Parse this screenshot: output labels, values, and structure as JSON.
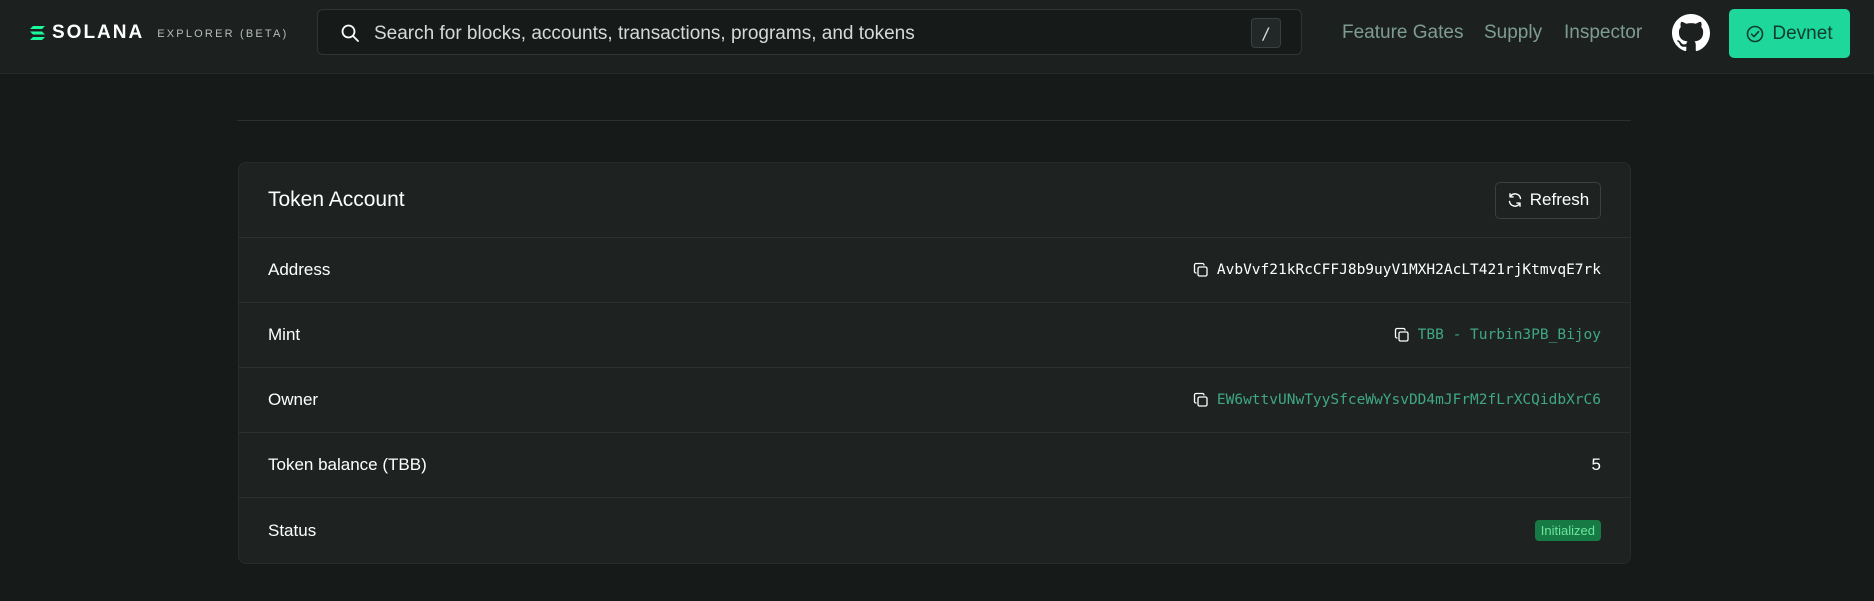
{
  "brand": {
    "name": "SOLANA",
    "subtitle": "EXPLORER (BETA)"
  },
  "search": {
    "placeholder": "Search for blocks, accounts, transactions, programs, and tokens",
    "shortcut": "/"
  },
  "nav": {
    "links": [
      "Feature Gates",
      "Supply",
      "Inspector"
    ],
    "cluster": "Devnet"
  },
  "card": {
    "title": "Token Account",
    "refresh_label": "Refresh",
    "rows": [
      {
        "label": "Address",
        "value": "AvbVvf21kRcCFFJ8b9uyV1MXH2AcLT421rjKtmvqE7rk"
      },
      {
        "label": "Mint",
        "value": "TBB - Turbin3PB_Bijoy"
      },
      {
        "label": "Owner",
        "value": "EW6wttvUNwTyySfceWwYsvDD4mJFrM2fLrXCQidbXrC6"
      },
      {
        "label": "Token balance (TBB)",
        "value": "5"
      },
      {
        "label": "Status",
        "value": "Initialized"
      }
    ]
  },
  "colors": {
    "accent": "#1dd79b",
    "link": "#3fa784",
    "background": "#161a19",
    "card": "#1e2322"
  }
}
